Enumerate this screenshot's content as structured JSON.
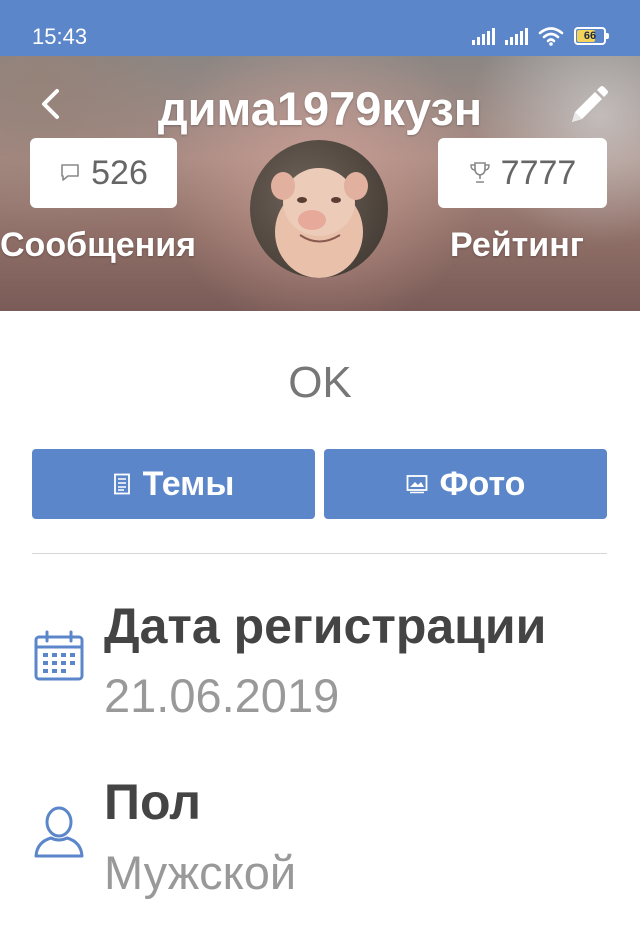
{
  "status_bar": {
    "time": "15:43",
    "battery": "66",
    "icons": [
      "signal-icon",
      "signal-icon",
      "wifi-icon",
      "battery-icon"
    ]
  },
  "header": {
    "back_icon": "chevron-left-icon",
    "username": "дима1979кузн",
    "edit_icon": "pencil-icon",
    "messages": {
      "icon": "speech-bubble-icon",
      "count": "526",
      "label": "Сообщения"
    },
    "rating": {
      "icon": "trophy-icon",
      "count": "7777",
      "label": "Рейтинг"
    }
  },
  "status_text": "OK",
  "buttons": {
    "topics": {
      "icon": "document-icon",
      "label": "Темы"
    },
    "photo": {
      "icon": "image-icon",
      "label": "Фото"
    }
  },
  "info": {
    "registration": {
      "icon": "calendar-icon",
      "label": "Дата регистрации",
      "value": "21.06.2019"
    },
    "gender": {
      "icon": "user-icon",
      "label": "Пол",
      "value": "Мужской"
    }
  },
  "colors": {
    "accent": "#5b86c9",
    "label_text": "#444444",
    "value_text": "#999999"
  }
}
